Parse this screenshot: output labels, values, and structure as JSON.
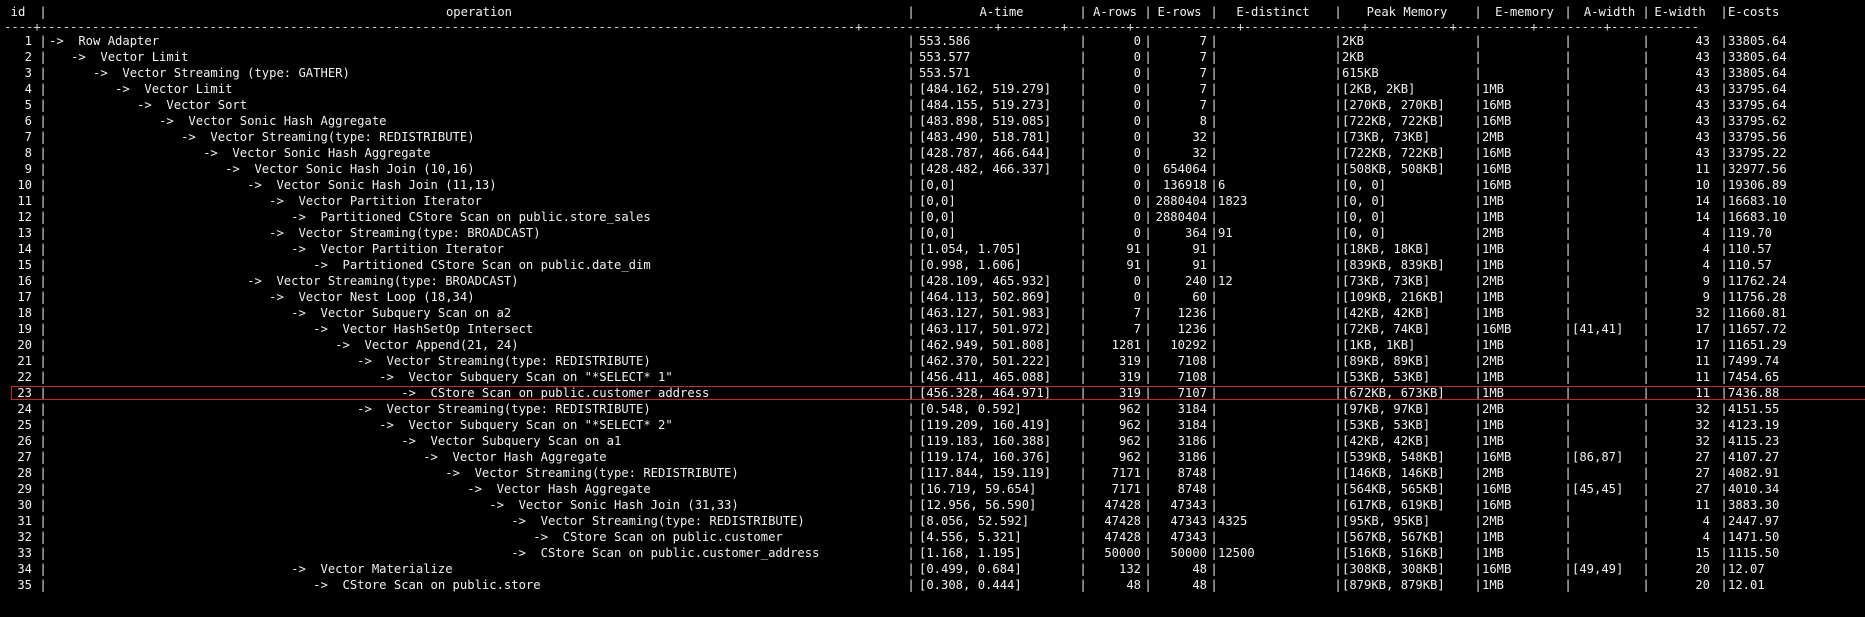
{
  "header": {
    "id": "id",
    "operation": "operation",
    "a_time": "A-time",
    "a_rows": "A-rows",
    "e_rows": "E-rows",
    "e_distinct": "E-distinct",
    "peak_memory": "Peak Memory",
    "e_memory": "E-memory",
    "a_width": "A-width",
    "e_width": "E-width",
    "e_costs": "E-costs"
  },
  "separator": "----+---------------------------------------------------------------------------------------------------------------+------------------+--------+--------+--------------+----------------+-----------+----------+---------+------------",
  "highlight_color": "#c62828",
  "highlighted_row_id": "23",
  "rows": [
    {
      "id": "1",
      "operation": "->  Row Adapter",
      "a_time": "553.586",
      "a_rows": "0",
      "e_rows": "7",
      "e_distinct": "",
      "peak_memory": "2KB",
      "e_memory": "",
      "a_width": "",
      "e_width": "43",
      "e_costs": "33805.64"
    },
    {
      "id": "2",
      "operation": "   ->  Vector Limit",
      "a_time": "553.577",
      "a_rows": "0",
      "e_rows": "7",
      "e_distinct": "",
      "peak_memory": "2KB",
      "e_memory": "",
      "a_width": "",
      "e_width": "43",
      "e_costs": "33805.64"
    },
    {
      "id": "3",
      "operation": "      ->  Vector Streaming (type: GATHER)",
      "a_time": "553.571",
      "a_rows": "0",
      "e_rows": "7",
      "e_distinct": "",
      "peak_memory": "615KB",
      "e_memory": "",
      "a_width": "",
      "e_width": "43",
      "e_costs": "33805.64"
    },
    {
      "id": "4",
      "operation": "         ->  Vector Limit",
      "a_time": "[484.162, 519.279]",
      "a_rows": "0",
      "e_rows": "7",
      "e_distinct": "",
      "peak_memory": "[2KB, 2KB]",
      "e_memory": "1MB",
      "a_width": "",
      "e_width": "43",
      "e_costs": "33795.64"
    },
    {
      "id": "5",
      "operation": "            ->  Vector Sort",
      "a_time": "[484.155, 519.273]",
      "a_rows": "0",
      "e_rows": "7",
      "e_distinct": "",
      "peak_memory": "[270KB, 270KB]",
      "e_memory": "16MB",
      "a_width": "",
      "e_width": "43",
      "e_costs": "33795.64"
    },
    {
      "id": "6",
      "operation": "               ->  Vector Sonic Hash Aggregate",
      "a_time": "[483.898, 519.085]",
      "a_rows": "0",
      "e_rows": "8",
      "e_distinct": "",
      "peak_memory": "[722KB, 722KB]",
      "e_memory": "16MB",
      "a_width": "",
      "e_width": "43",
      "e_costs": "33795.62"
    },
    {
      "id": "7",
      "operation": "                  ->  Vector Streaming(type: REDISTRIBUTE)",
      "a_time": "[483.490, 518.781]",
      "a_rows": "0",
      "e_rows": "32",
      "e_distinct": "",
      "peak_memory": "[73KB, 73KB]",
      "e_memory": "2MB",
      "a_width": "",
      "e_width": "43",
      "e_costs": "33795.56"
    },
    {
      "id": "8",
      "operation": "                     ->  Vector Sonic Hash Aggregate",
      "a_time": "[428.787, 466.644]",
      "a_rows": "0",
      "e_rows": "32",
      "e_distinct": "",
      "peak_memory": "[722KB, 722KB]",
      "e_memory": "16MB",
      "a_width": "",
      "e_width": "43",
      "e_costs": "33795.22"
    },
    {
      "id": "9",
      "operation": "                        ->  Vector Sonic Hash Join (10,16)",
      "a_time": "[428.482, 466.337]",
      "a_rows": "0",
      "e_rows": "654064",
      "e_distinct": "",
      "peak_memory": "[508KB, 508KB]",
      "e_memory": "16MB",
      "a_width": "",
      "e_width": "11",
      "e_costs": "32977.56"
    },
    {
      "id": "10",
      "operation": "                           ->  Vector Sonic Hash Join (11,13)",
      "a_time": "[0,0]",
      "a_rows": "0",
      "e_rows": "136918",
      "e_distinct": "6",
      "peak_memory": "[0, 0]",
      "e_memory": "16MB",
      "a_width": "",
      "e_width": "10",
      "e_costs": "19306.89"
    },
    {
      "id": "11",
      "operation": "                              ->  Vector Partition Iterator",
      "a_time": "[0,0]",
      "a_rows": "0",
      "e_rows": "2880404",
      "e_distinct": "1823",
      "peak_memory": "[0, 0]",
      "e_memory": "1MB",
      "a_width": "",
      "e_width": "14",
      "e_costs": "16683.10"
    },
    {
      "id": "12",
      "operation": "                                 ->  Partitioned CStore Scan on public.store_sales",
      "a_time": "[0,0]",
      "a_rows": "0",
      "e_rows": "2880404",
      "e_distinct": "",
      "peak_memory": "[0, 0]",
      "e_memory": "1MB",
      "a_width": "",
      "e_width": "14",
      "e_costs": "16683.10"
    },
    {
      "id": "13",
      "operation": "                              ->  Vector Streaming(type: BROADCAST)",
      "a_time": "[0,0]",
      "a_rows": "0",
      "e_rows": "364",
      "e_distinct": "91",
      "peak_memory": "[0, 0]",
      "e_memory": "2MB",
      "a_width": "",
      "e_width": "4",
      "e_costs": "119.70"
    },
    {
      "id": "14",
      "operation": "                                 ->  Vector Partition Iterator",
      "a_time": "[1.054, 1.705]",
      "a_rows": "91",
      "e_rows": "91",
      "e_distinct": "",
      "peak_memory": "[18KB, 18KB]",
      "e_memory": "1MB",
      "a_width": "",
      "e_width": "4",
      "e_costs": "110.57"
    },
    {
      "id": "15",
      "operation": "                                    ->  Partitioned CStore Scan on public.date_dim",
      "a_time": "[0.998, 1.606]",
      "a_rows": "91",
      "e_rows": "91",
      "e_distinct": "",
      "peak_memory": "[839KB, 839KB]",
      "e_memory": "1MB",
      "a_width": "",
      "e_width": "4",
      "e_costs": "110.57"
    },
    {
      "id": "16",
      "operation": "                           ->  Vector Streaming(type: BROADCAST)",
      "a_time": "[428.109, 465.932]",
      "a_rows": "0",
      "e_rows": "240",
      "e_distinct": "12",
      "peak_memory": "[73KB, 73KB]",
      "e_memory": "2MB",
      "a_width": "",
      "e_width": "9",
      "e_costs": "11762.24"
    },
    {
      "id": "17",
      "operation": "                              ->  Vector Nest Loop (18,34)",
      "a_time": "[464.113, 502.869]",
      "a_rows": "0",
      "e_rows": "60",
      "e_distinct": "",
      "peak_memory": "[109KB, 216KB]",
      "e_memory": "1MB",
      "a_width": "",
      "e_width": "9",
      "e_costs": "11756.28"
    },
    {
      "id": "18",
      "operation": "                                 ->  Vector Subquery Scan on a2",
      "a_time": "[463.127, 501.983]",
      "a_rows": "7",
      "e_rows": "1236",
      "e_distinct": "",
      "peak_memory": "[42KB, 42KB]",
      "e_memory": "1MB",
      "a_width": "",
      "e_width": "32",
      "e_costs": "11660.81"
    },
    {
      "id": "19",
      "operation": "                                    ->  Vector HashSetOp Intersect",
      "a_time": "[463.117, 501.972]",
      "a_rows": "7",
      "e_rows": "1236",
      "e_distinct": "",
      "peak_memory": "[72KB, 74KB]",
      "e_memory": "16MB",
      "a_width": "[41,41]",
      "e_width": "17",
      "e_costs": "11657.72"
    },
    {
      "id": "20",
      "operation": "                                       ->  Vector Append(21, 24)",
      "a_time": "[462.949, 501.808]",
      "a_rows": "1281",
      "e_rows": "10292",
      "e_distinct": "",
      "peak_memory": "[1KB, 1KB]",
      "e_memory": "1MB",
      "a_width": "",
      "e_width": "17",
      "e_costs": "11651.29"
    },
    {
      "id": "21",
      "operation": "                                          ->  Vector Streaming(type: REDISTRIBUTE)",
      "a_time": "[462.370, 501.222]",
      "a_rows": "319",
      "e_rows": "7108",
      "e_distinct": "",
      "peak_memory": "[89KB, 89KB]",
      "e_memory": "2MB",
      "a_width": "",
      "e_width": "11",
      "e_costs": "7499.74"
    },
    {
      "id": "22",
      "operation": "                                             ->  Vector Subquery Scan on \"*SELECT* 1\"",
      "a_time": "[456.411, 465.088]",
      "a_rows": "319",
      "e_rows": "7108",
      "e_distinct": "",
      "peak_memory": "[53KB, 53KB]",
      "e_memory": "1MB",
      "a_width": "",
      "e_width": "11",
      "e_costs": "7454.65"
    },
    {
      "id": "23",
      "operation": "                                                ->  CStore Scan on public.customer_address",
      "a_time": "[456.328, 464.971]",
      "a_rows": "319",
      "e_rows": "7107",
      "e_distinct": "",
      "peak_memory": "[672KB, 673KB]",
      "e_memory": "1MB",
      "a_width": "",
      "e_width": "11",
      "e_costs": "7436.88"
    },
    {
      "id": "24",
      "operation": "                                          ->  Vector Streaming(type: REDISTRIBUTE)",
      "a_time": "[0.548, 0.592]",
      "a_rows": "962",
      "e_rows": "3184",
      "e_distinct": "",
      "peak_memory": "[97KB, 97KB]",
      "e_memory": "2MB",
      "a_width": "",
      "e_width": "32",
      "e_costs": "4151.55"
    },
    {
      "id": "25",
      "operation": "                                             ->  Vector Subquery Scan on \"*SELECT* 2\"",
      "a_time": "[119.209, 160.419]",
      "a_rows": "962",
      "e_rows": "3184",
      "e_distinct": "",
      "peak_memory": "[53KB, 53KB]",
      "e_memory": "1MB",
      "a_width": "",
      "e_width": "32",
      "e_costs": "4123.19"
    },
    {
      "id": "26",
      "operation": "                                                ->  Vector Subquery Scan on a1",
      "a_time": "[119.183, 160.388]",
      "a_rows": "962",
      "e_rows": "3186",
      "e_distinct": "",
      "peak_memory": "[42KB, 42KB]",
      "e_memory": "1MB",
      "a_width": "",
      "e_width": "32",
      "e_costs": "4115.23"
    },
    {
      "id": "27",
      "operation": "                                                   ->  Vector Hash Aggregate",
      "a_time": "[119.174, 160.376]",
      "a_rows": "962",
      "e_rows": "3186",
      "e_distinct": "",
      "peak_memory": "[539KB, 548KB]",
      "e_memory": "16MB",
      "a_width": "[86,87]",
      "e_width": "27",
      "e_costs": "4107.27"
    },
    {
      "id": "28",
      "operation": "                                                      ->  Vector Streaming(type: REDISTRIBUTE)",
      "a_time": "[117.844, 159.119]",
      "a_rows": "7171",
      "e_rows": "8748",
      "e_distinct": "",
      "peak_memory": "[146KB, 146KB]",
      "e_memory": "2MB",
      "a_width": "",
      "e_width": "27",
      "e_costs": "4082.91"
    },
    {
      "id": "29",
      "operation": "                                                         ->  Vector Hash Aggregate",
      "a_time": "[16.719, 59.654]",
      "a_rows": "7171",
      "e_rows": "8748",
      "e_distinct": "",
      "peak_memory": "[564KB, 565KB]",
      "e_memory": "16MB",
      "a_width": "[45,45]",
      "e_width": "27",
      "e_costs": "4010.34"
    },
    {
      "id": "30",
      "operation": "                                                            ->  Vector Sonic Hash Join (31,33)",
      "a_time": "[12.956, 56.590]",
      "a_rows": "47428",
      "e_rows": "47343",
      "e_distinct": "",
      "peak_memory": "[617KB, 619KB]",
      "e_memory": "16MB",
      "a_width": "",
      "e_width": "11",
      "e_costs": "3883.30"
    },
    {
      "id": "31",
      "operation": "                                                               ->  Vector Streaming(type: REDISTRIBUTE)",
      "a_time": "[8.056, 52.592]",
      "a_rows": "47428",
      "e_rows": "47343",
      "e_distinct": "4325",
      "peak_memory": "[95KB, 95KB]",
      "e_memory": "2MB",
      "a_width": "",
      "e_width": "4",
      "e_costs": "2447.97"
    },
    {
      "id": "32",
      "operation": "                                                                  ->  CStore Scan on public.customer",
      "a_time": "[4.556, 5.321]",
      "a_rows": "47428",
      "e_rows": "47343",
      "e_distinct": "",
      "peak_memory": "[567KB, 567KB]",
      "e_memory": "1MB",
      "a_width": "",
      "e_width": "4",
      "e_costs": "1471.50"
    },
    {
      "id": "33",
      "operation": "                                                               ->  CStore Scan on public.customer_address",
      "a_time": "[1.168, 1.195]",
      "a_rows": "50000",
      "e_rows": "50000",
      "e_distinct": "12500",
      "peak_memory": "[516KB, 516KB]",
      "e_memory": "1MB",
      "a_width": "",
      "e_width": "15",
      "e_costs": "1115.50"
    },
    {
      "id": "34",
      "operation": "                                 ->  Vector Materialize",
      "a_time": "[0.499, 0.684]",
      "a_rows": "132",
      "e_rows": "48",
      "e_distinct": "",
      "peak_memory": "[308KB, 308KB]",
      "e_memory": "16MB",
      "a_width": "[49,49]",
      "e_width": "20",
      "e_costs": "12.07"
    },
    {
      "id": "35",
      "operation": "                                    ->  CStore Scan on public.store",
      "a_time": "[0.308, 0.444]",
      "a_rows": "48",
      "e_rows": "48",
      "e_distinct": "",
      "peak_memory": "[879KB, 879KB]",
      "e_memory": "1MB",
      "a_width": "",
      "e_width": "20",
      "e_costs": "12.01"
    }
  ]
}
